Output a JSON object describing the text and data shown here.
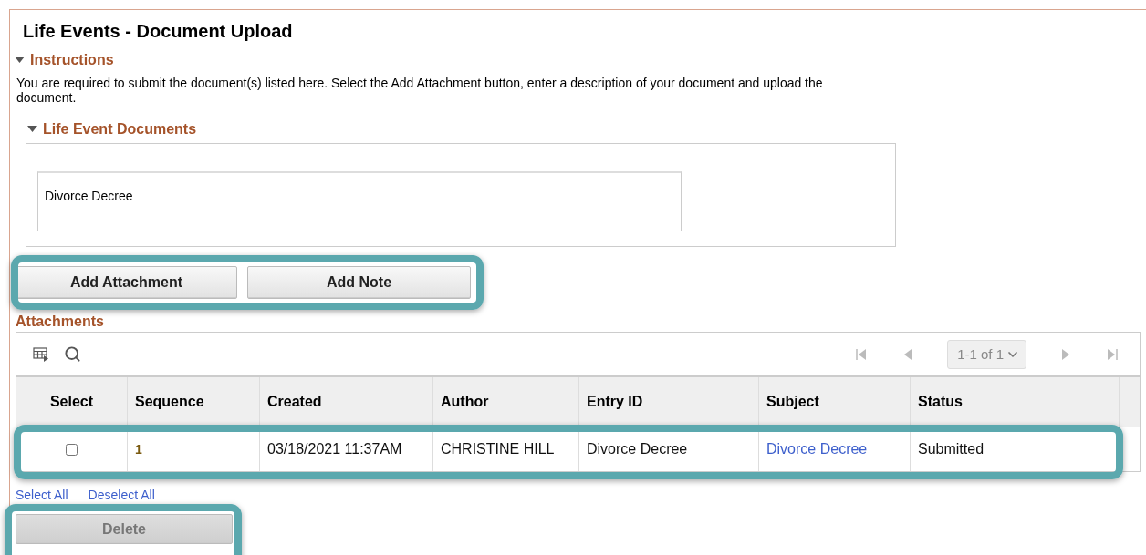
{
  "title": "Life Events - Document Upload",
  "instructions": {
    "label": "Instructions",
    "expanded": true,
    "text": "You are required to submit the document(s) listed here. Select the Add Attachment button, enter a description of your document and upload the document."
  },
  "documents": {
    "label": "Life Event Documents",
    "expanded": true,
    "items": [
      "Divorce Decree"
    ]
  },
  "action_buttons": {
    "highlighted": true,
    "buttons": [
      "Add Attachment",
      "Add Note"
    ]
  },
  "attachments": {
    "label": "Attachments",
    "pager": {
      "range": "1-1 of 1"
    },
    "columns": [
      "Select",
      "Sequence",
      "Created",
      "Author",
      "Entry ID",
      "Subject",
      "Status"
    ],
    "rows": [
      {
        "checked": false,
        "highlighted": true,
        "sequence": "1",
        "created": "03/18/2021 11:37AM",
        "author": "CHRISTINE HILL",
        "entry_id": "Divorce Decree",
        "subject": "Divorce Decree",
        "status": "Submitted"
      }
    ],
    "links": [
      "Select All",
      "Deselect All"
    ]
  },
  "delete_button": {
    "label": "Delete",
    "disabled": true,
    "highlighted": true
  }
}
